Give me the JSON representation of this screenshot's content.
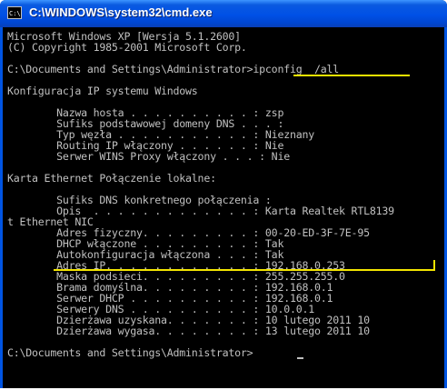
{
  "window": {
    "title": "C:\\WINDOWS\\system32\\cmd.exe",
    "icon_label": "C:\\"
  },
  "console": {
    "lines": [
      "Microsoft Windows XP [Wersja 5.1.2600]",
      "(C) Copyright 1985-2001 Microsoft Corp.",
      "",
      "C:\\Documents and Settings\\Administrator>ipconfig  /all",
      "",
      "Konfiguracja IP systemu Windows",
      "",
      "        Nazwa hosta . . . . . . . . . . : zsp",
      "        Sufiks podstawowej domeny DNS . . . :",
      "        Typ węzła . . . . . . . . . . . : Nieznany",
      "        Routing IP włączony . . . . . . : Nie",
      "        Serwer WINS Proxy włączony . . . : Nie",
      "",
      "Karta Ethernet Połączenie lokalne:",
      "",
      "        Sufiks DNS konkretnego połączenia :",
      "        Opis  . . . . . . . . . . . . . : Karta Realtek RTL8139",
      "t Ethernet NIC",
      "        Adres fizyczny. . . . . . . . . : 00-20-ED-3F-7E-95",
      "        DHCP włączone . . . . . . . . . : Tak",
      "        Autokonfiguracja włączona . . . : Tak",
      "        Adres IP. . . . . . . . . . . . : 192.168.0.253",
      "        Maska podsieci. . . . . . . . . : 255.255.255.0",
      "        Brama domyślna. . . . . . . . . : 192.168.0.1",
      "        Serwer DHCP . . . . . . . . . . : 192.168.0.1",
      "        Serwery DNS . . . . . . . . . . : 10.0.0.1",
      "        Dzierżawa uzyskana. . . . . . . : 10 lutego 2011 10",
      "        Dzierżawa wygasa. . . . . . . . : 13 lutego 2011 10",
      "",
      "C:\\Documents and Settings\\Administrator>"
    ]
  },
  "colors": {
    "console_background": "#000000",
    "console_text": "#c0c0c0",
    "highlight": "#f2e400",
    "titlebar": "#0054e3"
  }
}
